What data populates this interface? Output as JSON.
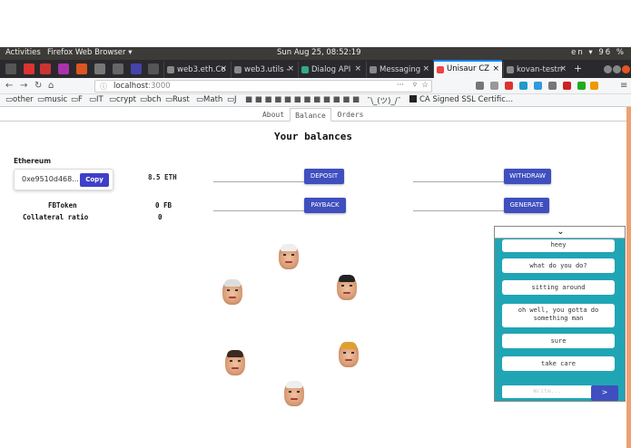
{
  "topbar": {
    "activities": "Activities",
    "app": "Firefox Web Browser ▾",
    "clock": "Sun Aug 25, 08:52:19",
    "lang": "en ▾",
    "battery": "96 %"
  },
  "tabs": [
    {
      "label": "web3.eth.Co"
    },
    {
      "label": "web3.utils -"
    },
    {
      "label": "Dialog API"
    },
    {
      "label": "Messaging"
    },
    {
      "label": "Unisaur CZ"
    },
    {
      "label": "kovan-testn"
    }
  ],
  "url": {
    "host": "localhost",
    "port": ":3000"
  },
  "bookmarks": [
    "other",
    "music",
    "F",
    "IT",
    "crypt",
    "bch",
    "Rust",
    "Math",
    "J",
    "¯\\_(ツ)_/¯",
    "CA Signed SSL Certific..."
  ],
  "app_tabs": [
    "About",
    "Balance",
    "Orders"
  ],
  "page": {
    "heading": "Your balances",
    "eth_label": "Ethereum",
    "address": "0xe9510d468...",
    "copy": "Copy",
    "eth_amount": "8.5 ETH",
    "fb_label": "FBToken",
    "fb_amount": "0 FB",
    "collateral_label": "Collateral ratio",
    "collateral_value": "0",
    "deposit": "DEPOSIT",
    "withdraw": "WITHDRAW",
    "payback": "PAYBACK",
    "generate": "GENERATE"
  },
  "chat": {
    "header_icon": "chevron-down-icon",
    "messages": [
      "heey",
      "what do you do?",
      "sitting around",
      "oh well, you gotta do something man",
      "sure",
      "take care"
    ],
    "input_placeholder": "Write...",
    "send": ">"
  },
  "colors": {
    "accent_button": "#3f4fbf",
    "chat_bg": "#20a5b5",
    "tab_highlight": "#0a84ff"
  }
}
